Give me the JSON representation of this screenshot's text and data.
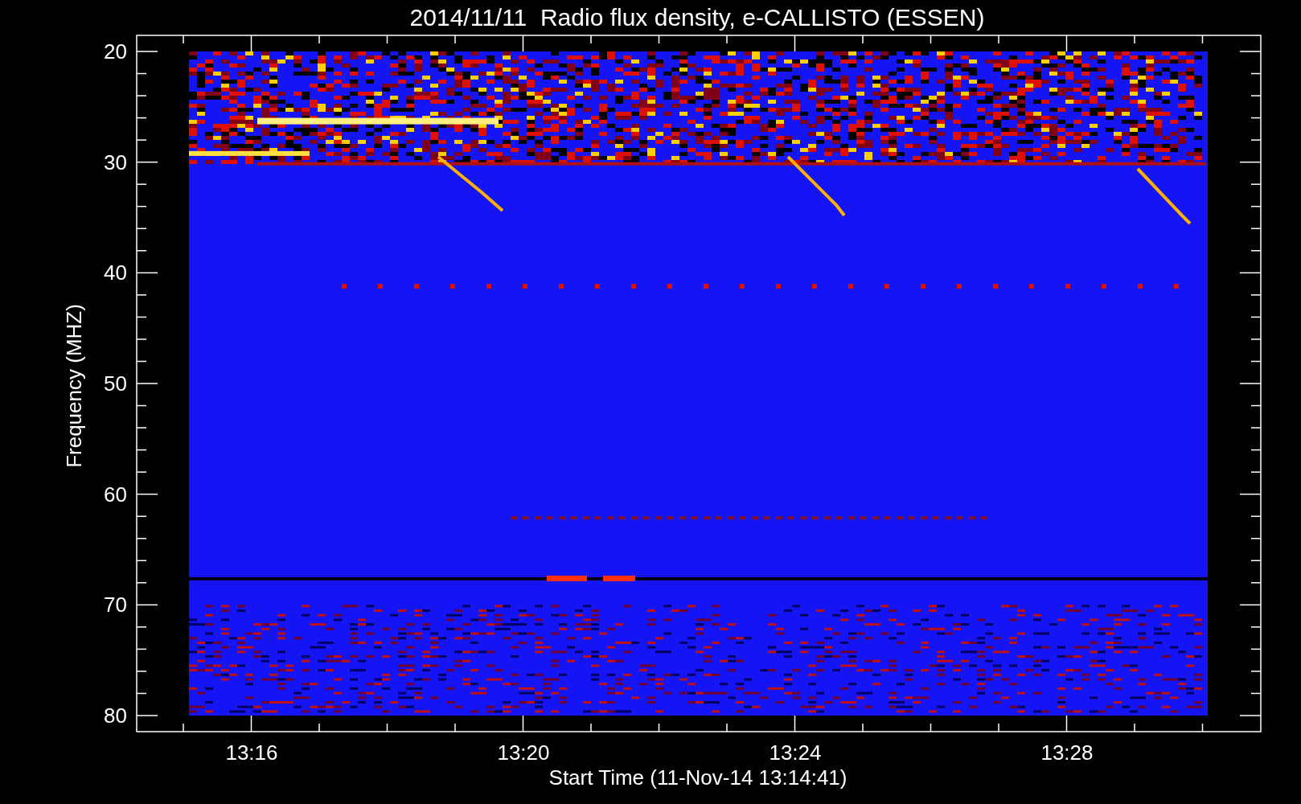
{
  "title": "2014/11/11  Radio flux density, e-CALLISTO (ESSEN)",
  "y_axis": {
    "label": "Frequency (MHZ)",
    "ticks": [
      "20",
      "30",
      "40",
      "50",
      "60",
      "70",
      "80"
    ]
  },
  "x_axis": {
    "label": "Start Time (11-Nov-14 13:14:41)",
    "ticks": [
      "13:16",
      "13:20",
      "13:24",
      "13:28"
    ]
  }
}
